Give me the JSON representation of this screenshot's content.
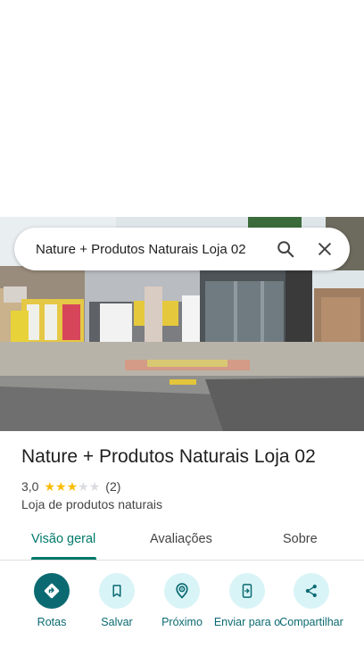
{
  "search": {
    "query": "Nature + Produtos Naturais Loja 02"
  },
  "place": {
    "name": "Nature + Produtos Naturais Loja 02",
    "rating": "3,0",
    "stars_filled": 3,
    "stars_total": 5,
    "reviews_count": "(2)",
    "category": "Loja de produtos naturais"
  },
  "tabs": [
    {
      "label": "Visão geral",
      "active": true
    },
    {
      "label": "Avaliações",
      "active": false
    },
    {
      "label": "Sobre",
      "active": false
    }
  ],
  "actions": [
    {
      "label": "Rotas",
      "icon": "directions-icon"
    },
    {
      "label": "Salvar",
      "icon": "bookmark-icon"
    },
    {
      "label": "Próximo",
      "icon": "nearby-icon"
    },
    {
      "label": "Enviar para o",
      "icon": "send-to-phone-icon"
    },
    {
      "label": "Compartilhar",
      "icon": "share-icon"
    }
  ],
  "colors": {
    "accent": "#0b6a71",
    "tab_active": "#00796b",
    "action_bg": "#d9f4f7",
    "star": "#fbbc04",
    "star_empty": "#dadce0"
  }
}
